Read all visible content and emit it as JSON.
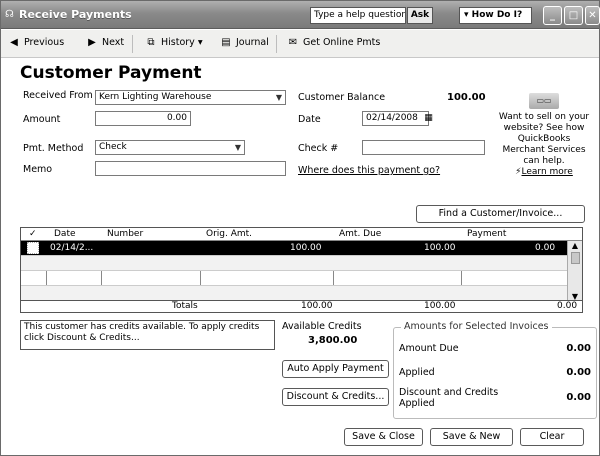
{
  "window": {
    "title": "Receive Payments",
    "help_placeholder": "Type a help question",
    "ask_label": "Ask",
    "howdo_label": "How Do I?"
  },
  "toolbar": {
    "previous": "Previous",
    "next": "Next",
    "history": "History",
    "journal": "Journal",
    "online_pmts": "Get Online Pmts"
  },
  "form": {
    "title": "Customer Payment",
    "received_from_label": "Received From",
    "received_from_value": "Kern Lighting Warehouse",
    "customer_balance_label": "Customer Balance",
    "customer_balance_value": "100.00",
    "amount_label": "Amount",
    "amount_value": "0.00",
    "date_label": "Date",
    "date_value": "02/14/2008",
    "pmt_method_label": "Pmt. Method",
    "pmt_method_value": "Check",
    "check_label": "Check #",
    "check_value": "",
    "memo_label": "Memo",
    "memo_value": "",
    "where_link": "Where does this payment go?"
  },
  "promo": {
    "text": "Want to sell on your website? See how QuickBooks Merchant Services can help.",
    "learn_more": "Learn more"
  },
  "find_button": "Find a Customer/Invoice...",
  "grid": {
    "columns": [
      "✓",
      "Date",
      "Number",
      "Orig. Amt.",
      "Amt. Due",
      "Payment"
    ],
    "rows": [
      {
        "checked": "",
        "date": "02/14/2...",
        "number": "",
        "orig_amt": "100.00",
        "amt_due": "100.00",
        "payment": "0.00"
      }
    ],
    "totals_label": "Totals",
    "totals_orig": "100.00",
    "totals_due": "100.00",
    "totals_payment": "0.00"
  },
  "credits": {
    "message": "This customer has credits available. To apply credits click Discount & Credits...",
    "available_label": "Available Credits",
    "available_value": "3,800.00"
  },
  "buttons": {
    "auto_apply": "Auto Apply Payment",
    "discount_credits": "Discount & Credits...",
    "save_close": "Save & Close",
    "save_new": "Save & New",
    "clear": "Clear"
  },
  "selected": {
    "title": "Amounts for Selected Invoices",
    "amount_due_label": "Amount Due",
    "amount_due_value": "0.00",
    "applied_label": "Applied",
    "applied_value": "0.00",
    "discount_label": "Discount and Credits Applied",
    "discount_value": "0.00"
  }
}
